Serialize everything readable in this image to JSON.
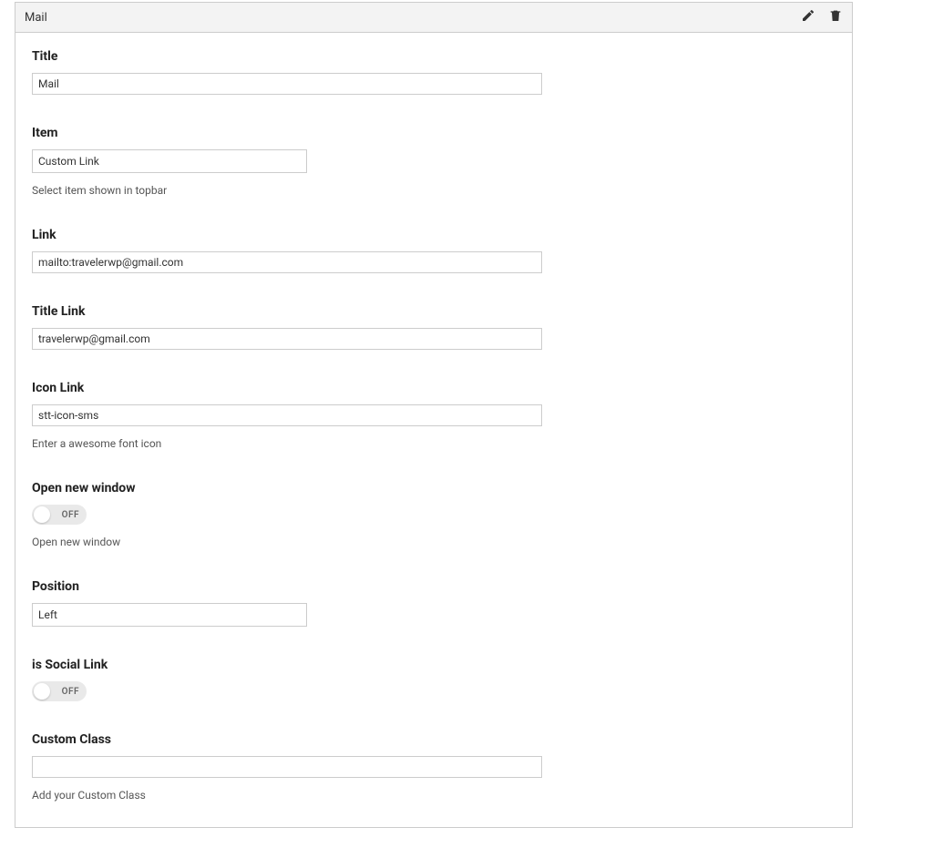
{
  "header": {
    "title": "Mail"
  },
  "fields": {
    "title": {
      "label": "Title",
      "value": "Mail"
    },
    "item": {
      "label": "Item",
      "value": "Custom Link",
      "helper": "Select item shown in topbar"
    },
    "link": {
      "label": "Link",
      "value": "mailto:travelerwp@gmail.com"
    },
    "title_link": {
      "label": "Title Link",
      "value": "travelerwp@gmail.com"
    },
    "icon_link": {
      "label": "Icon Link",
      "value": "stt-icon-sms",
      "helper": "Enter a awesome font icon"
    },
    "open_new_window": {
      "label": "Open new window",
      "state": "OFF",
      "helper": "Open new window"
    },
    "position": {
      "label": "Position",
      "value": "Left"
    },
    "is_social_link": {
      "label": "is Social Link",
      "state": "OFF"
    },
    "custom_class": {
      "label": "Custom Class",
      "value": "",
      "helper": "Add your Custom Class"
    }
  }
}
